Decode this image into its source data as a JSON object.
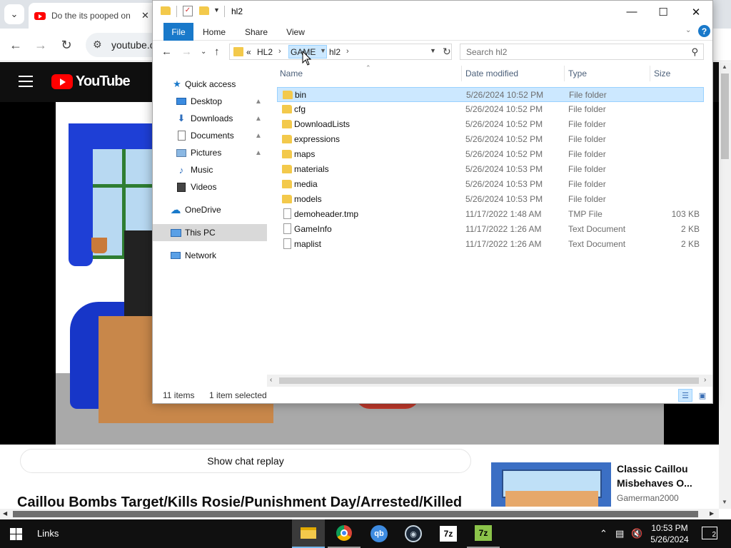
{
  "browser": {
    "tab_title": "Do the its pooped on",
    "url": "youtube.c",
    "icons": {
      "tab_search": "chevron-down-icon",
      "close": "close-icon",
      "back": "back-arrow-icon",
      "forward": "forward-arrow-icon",
      "reload": "reload-icon",
      "site_info": "tune-icon"
    }
  },
  "youtube": {
    "logo_text": "YouTube",
    "chat_replay": "Show chat replay",
    "video_title": "Caillou Bombs Target/Kills Rosie/Punishment Day/Arrested/Killed",
    "recommended": {
      "title": "Classic Caillou Misbehaves O...",
      "channel": "Gamerman2000"
    }
  },
  "explorer": {
    "title": "hl2",
    "ribbon_tabs": [
      "File",
      "Home",
      "Share",
      "View"
    ],
    "breadcrumb": {
      "overflow": "«",
      "items": [
        "HL2",
        "GAME",
        "hl2"
      ],
      "highlighted": "GAME"
    },
    "search_placeholder": "Search hl2",
    "nav_pane": [
      {
        "label": "Quick access",
        "icon": "star-icon",
        "pinned": false
      },
      {
        "label": "Desktop",
        "icon": "desktop-icon",
        "pinned": true
      },
      {
        "label": "Downloads",
        "icon": "download-icon",
        "pinned": true
      },
      {
        "label": "Documents",
        "icon": "document-icon",
        "pinned": true
      },
      {
        "label": "Pictures",
        "icon": "picture-icon",
        "pinned": true
      },
      {
        "label": "Music",
        "icon": "music-icon",
        "pinned": false
      },
      {
        "label": "Videos",
        "icon": "video-icon",
        "pinned": false
      },
      {
        "label": "OneDrive",
        "icon": "cloud-icon",
        "pinned": false
      },
      {
        "label": "This PC",
        "icon": "computer-icon",
        "pinned": false,
        "selected": true
      },
      {
        "label": "Network",
        "icon": "network-icon",
        "pinned": false
      }
    ],
    "columns": [
      "Name",
      "Date modified",
      "Type",
      "Size"
    ],
    "files": [
      {
        "name": "bin",
        "date": "5/26/2024 10:52 PM",
        "type": "File folder",
        "size": "",
        "kind": "folder",
        "selected": true
      },
      {
        "name": "cfg",
        "date": "5/26/2024 10:52 PM",
        "type": "File folder",
        "size": "",
        "kind": "folder"
      },
      {
        "name": "DownloadLists",
        "date": "5/26/2024 10:52 PM",
        "type": "File folder",
        "size": "",
        "kind": "folder"
      },
      {
        "name": "expressions",
        "date": "5/26/2024 10:52 PM",
        "type": "File folder",
        "size": "",
        "kind": "folder"
      },
      {
        "name": "maps",
        "date": "5/26/2024 10:52 PM",
        "type": "File folder",
        "size": "",
        "kind": "folder"
      },
      {
        "name": "materials",
        "date": "5/26/2024 10:53 PM",
        "type": "File folder",
        "size": "",
        "kind": "folder"
      },
      {
        "name": "media",
        "date": "5/26/2024 10:53 PM",
        "type": "File folder",
        "size": "",
        "kind": "folder"
      },
      {
        "name": "models",
        "date": "5/26/2024 10:53 PM",
        "type": "File folder",
        "size": "",
        "kind": "folder"
      },
      {
        "name": "demoheader.tmp",
        "date": "11/17/2022 1:48 AM",
        "type": "TMP File",
        "size": "103 KB",
        "kind": "file"
      },
      {
        "name": "GameInfo",
        "date": "11/17/2022 1:26 AM",
        "type": "Text Document",
        "size": "2 KB",
        "kind": "file"
      },
      {
        "name": "maplist",
        "date": "11/17/2022 1:26 AM",
        "type": "Text Document",
        "size": "2 KB",
        "kind": "file"
      }
    ],
    "status": {
      "item_count": "11 items",
      "selection": "1 item selected"
    }
  },
  "taskbar": {
    "links_label": "Links",
    "time": "10:53 PM",
    "date": "5/26/2024",
    "notification_count": "2",
    "apps": [
      {
        "name": "File Explorer",
        "icon": "folder-icon",
        "state": "active"
      },
      {
        "name": "Google Chrome",
        "icon": "chrome-icon",
        "state": "open"
      },
      {
        "name": "qBittorrent",
        "icon": "qbittorrent-icon",
        "state": "pinned",
        "glyph": "qb"
      },
      {
        "name": "Steam",
        "icon": "steam-icon",
        "state": "pinned"
      },
      {
        "name": "7-Zip",
        "icon": "7zip-icon",
        "state": "pinned",
        "glyph": "7z"
      },
      {
        "name": "7-Zip File Manager",
        "icon": "7zip-icon",
        "state": "open",
        "glyph": "7z"
      }
    ]
  },
  "colors": {
    "accent": "#1979ca",
    "selection": "#cce8ff",
    "folder": "#f3c94b",
    "youtube_red": "#ff0000"
  }
}
